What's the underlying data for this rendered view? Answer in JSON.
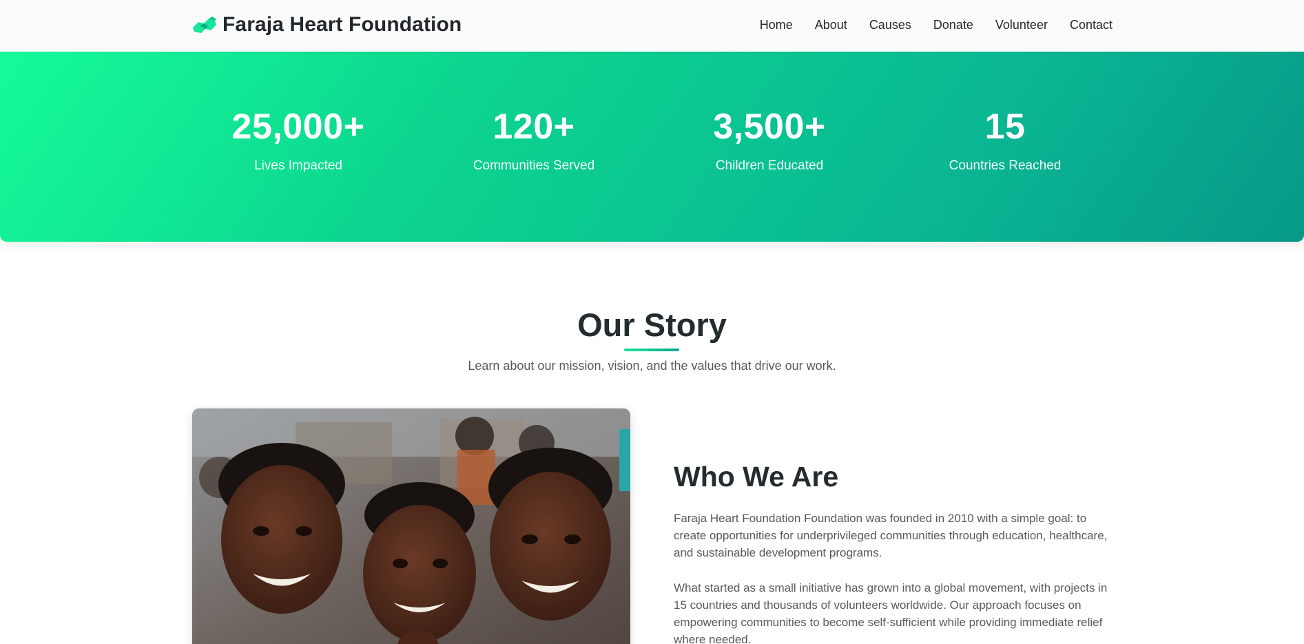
{
  "brand": {
    "name": "Faraja Heart Foundation",
    "icon": "handshake-icon",
    "accent_color": "#16e79a"
  },
  "nav": {
    "items": [
      {
        "label": "Home"
      },
      {
        "label": "About"
      },
      {
        "label": "Causes"
      },
      {
        "label": "Donate"
      },
      {
        "label": "Volunteer"
      },
      {
        "label": "Contact"
      }
    ]
  },
  "stats": [
    {
      "value": "25,000+",
      "label": "Lives Impacted"
    },
    {
      "value": "120+",
      "label": "Communities Served"
    },
    {
      "value": "3,500+",
      "label": "Children Educated"
    },
    {
      "value": "15",
      "label": "Countries Reached"
    }
  ],
  "story": {
    "title": "Our Story",
    "subtitle": "Learn about our mission, vision, and the values that drive our work."
  },
  "who": {
    "image": "children-smiling-photo",
    "title": "Who We Are",
    "paragraphs": [
      "Faraja Heart Foundation Foundation was founded in 2010 with a simple goal: to create opportunities for underprivileged communities through education, healthcare, and sustainable development programs.",
      "What started as a small initiative has grown into a global movement, with projects in 15 countries and thousands of volunteers worldwide. Our approach focuses on empowering communities to become self-sufficient while providing immediate relief where needed."
    ]
  }
}
